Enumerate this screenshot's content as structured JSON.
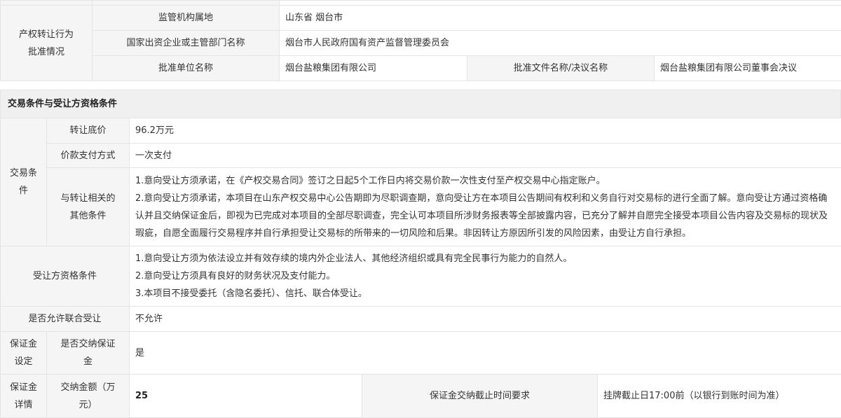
{
  "approval": {
    "group_label": "产权转让行为批准情况",
    "rows": [
      {
        "label": "监管机构属地",
        "value": "山东省 烟台市"
      },
      {
        "label": "国家出资企业或主管部门名称",
        "value": "烟台市人民政府国有资产监督管理委员会"
      }
    ],
    "unit_label": "批准单位名称",
    "unit_value": "烟台盐粮集团有限公司",
    "doc_label": "批准文件名称/决议名称",
    "doc_value": "烟台盐粮集团有限公司董事会决议"
  },
  "trade_section": {
    "title": "交易条件与受让方资格条件",
    "conditions_group": "交易条件",
    "base_price_label": "转让底价",
    "base_price_value": "96.2万元",
    "payment_label": "价款支付方式",
    "payment_value": "一次支付",
    "other_label": "与转让相关的其他条件",
    "other_lines": [
      "1.意向受让方须承诺，在《产权交易合同》签订之日起5个工作日内将交易价款一次性支付至产权交易中心指定账户。",
      "2.意向受让方须承诺，本项目在山东产权交易中心公告期即为尽职调查期，意向受让方在本项目公告期间有权利和义务自行对交易标的进行全面了解。意向受让方通过资格确认并且交纳保证金后，即视为已完成对本项目的全部尽职调查，完全认可本项目所涉财务报表等全部披露内容，已充分了解并自愿完全接受本项目公告内容及交易标的现状及瑕疵，自愿全面履行交易程序并自行承担受让交易标的所带来的一切风险和后果。非因转让方原因所引发的风险因素，由受让方自行承担。"
    ],
    "qualification_label": "受让方资格条件",
    "qualification_lines": [
      "1.意向受让方须为依法设立并有效存续的境内外企业法人、其他经济组织或具有完全民事行为能力的自然人。",
      "2.意向受让方须具有良好的财务状况及支付能力。",
      "3.本项目不接受委托（含隐名委托）、信托、联合体受让。"
    ],
    "joint_label": "是否允许联合受让",
    "joint_value": "不允许",
    "deposit_setting_group": "保证金设定",
    "deposit_required_label": "是否交纳保证金",
    "deposit_required_value": "是",
    "deposit_detail_group": "保证金详情",
    "deposit_amount_label": "交纳金额（万元）",
    "deposit_amount_value": "25",
    "deposit_deadline_label": "保证金交纳截止时间要求",
    "deposit_deadline_value": "挂牌截止日17:00前（以银行到账时间为准）"
  }
}
